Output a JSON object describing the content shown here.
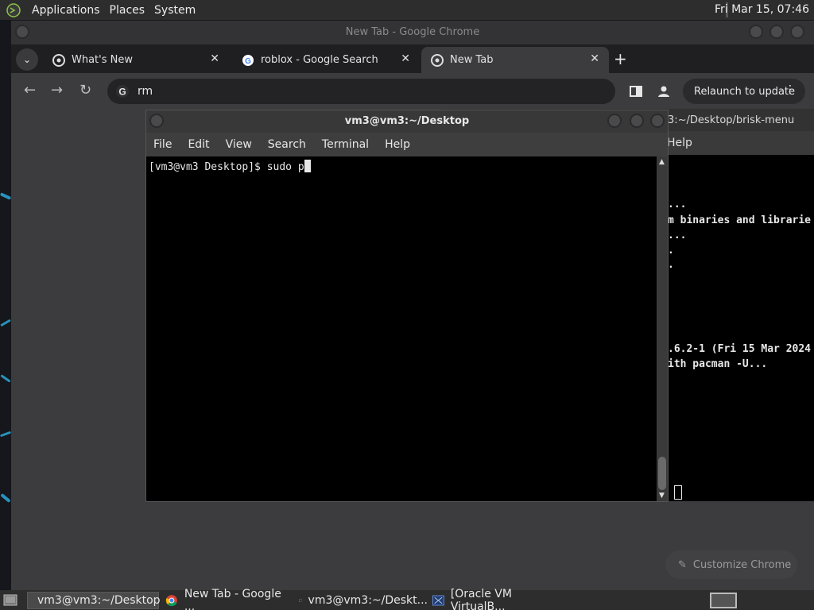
{
  "top_panel": {
    "menus": [
      "Applications",
      "Places",
      "System"
    ],
    "clock": "Fri Mar 15, 07:46"
  },
  "chrome": {
    "window_title": "New Tab - Google Chrome",
    "tabs": [
      {
        "label": "What's New",
        "icon": "chrome-icon"
      },
      {
        "label": "roblox - Google Search",
        "icon": "google-g-icon"
      },
      {
        "label": "New Tab",
        "icon": "chrome-icon",
        "active": true
      }
    ],
    "omnibox_value": "rm",
    "relaunch_label": "Relaunch to update",
    "customize_label": "Customize Chrome"
  },
  "term_bg": {
    "title_fragment": "3:~/Desktop/brisk-menu",
    "menu_fragment": "Help",
    "lines": [
      {
        "text": "..."
      },
      {
        "text": "m binaries and librarie"
      },
      {
        "text": "..."
      },
      {
        "text": "."
      },
      {
        "text": "."
      },
      {
        "text": ".6.2-1 (Fri 15 Mar 2024"
      },
      {
        "text": "ith pacman -U..."
      }
    ]
  },
  "terminal": {
    "title": "vm3@vm3:~/Desktop",
    "menu": [
      "File",
      "Edit",
      "View",
      "Search",
      "Terminal",
      "Help"
    ],
    "prompt_line": "[vm3@vm3 Desktop]$ sudo p"
  },
  "taskbar": {
    "items": [
      {
        "label": "vm3@vm3:~/Desktop",
        "icon": "terminal-icon"
      },
      {
        "label": "New Tab - Google ...",
        "icon": "chrome-icon"
      },
      {
        "label": "vm3@vm3:~/Deskt...",
        "icon": "terminal-icon"
      },
      {
        "label": "[Oracle VM VirtualB...",
        "icon": "virtualbox-icon"
      }
    ]
  }
}
